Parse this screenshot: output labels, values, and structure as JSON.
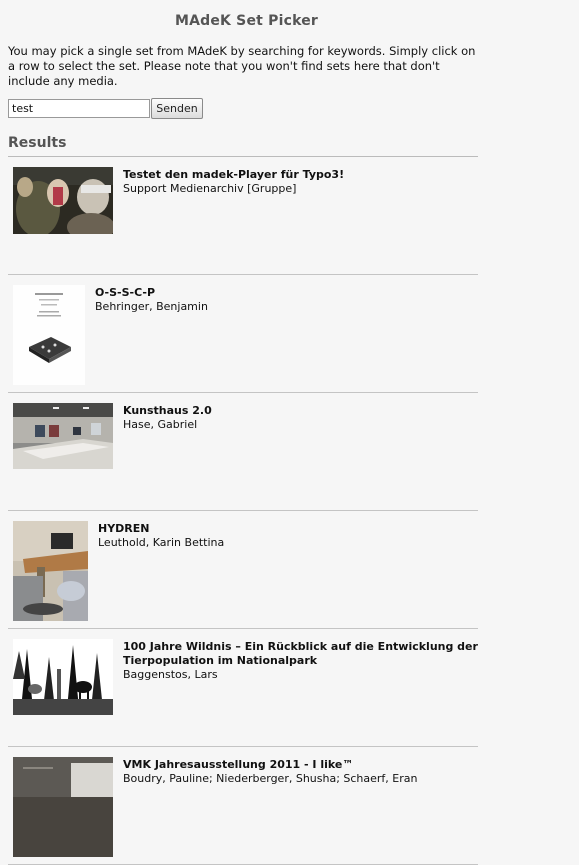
{
  "header": {
    "title": "MAdeK Set Picker"
  },
  "intro": "You may pick a single set from MAdeK by searching for keywords. Simply click on a row to select the set. Please note that you won't find sets here that don't include any media.",
  "search": {
    "value": "test",
    "button_label": "Senden"
  },
  "results_heading": "Results",
  "results": [
    {
      "title": "Testet den madek-Player für Typo3!",
      "author": "Support Medienarchiv [Gruppe]",
      "thumb": "crowd-photo"
    },
    {
      "title": "O-S-S-C-P",
      "author": "Behringer, Benjamin",
      "thumb": "document-page"
    },
    {
      "title": "Kunsthaus 2.0",
      "author": "Hase, Gabriel",
      "thumb": "gallery-room"
    },
    {
      "title": "HYDREN",
      "author": "Leuthold, Karin Bettina",
      "thumb": "desk-photo"
    },
    {
      "title": "100 Jahre Wildnis – Ein Rückblick auf die Entwicklung der Tierpopulation im Nationalpark",
      "author": "Baggenstos, Lars",
      "thumb": "forest-illustration"
    },
    {
      "title": "VMK Jahresausstellung 2011 - I like™",
      "author": "Boudry, Pauline; Niederberger, Shusha; Schaerf, Eran",
      "thumb": "exhibition-room"
    }
  ]
}
